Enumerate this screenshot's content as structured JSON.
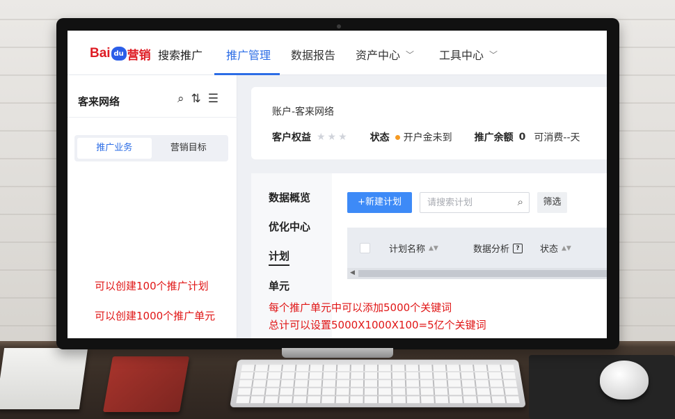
{
  "nav": {
    "logo_bai": "Bai",
    "logo_du": "du",
    "logo_yx": "营销",
    "product": "搜索推广",
    "items": [
      {
        "label": "推广管理",
        "active": true
      },
      {
        "label": "数据报告"
      },
      {
        "label": "资产中心"
      },
      {
        "label": "工具中心"
      }
    ]
  },
  "left": {
    "account_title": "客来网络",
    "tabs": [
      "推广业务",
      "营销目标"
    ],
    "notes": [
      "可以创建100个推广计划",
      "可以创建1000个推广单元"
    ]
  },
  "account": {
    "crumb": "账户-客来网络",
    "rights_label": "客户权益",
    "status_label": "状态",
    "status_value": "开户金未到",
    "balance_label": "推广余额",
    "balance_value": "0",
    "spend_text": "可消费--天"
  },
  "submenu": [
    "数据概览",
    "优化中心",
    "计划",
    "单元"
  ],
  "toolbar": {
    "new_plan": "+新建计划",
    "search_placeholder": "请搜索计划",
    "filter": "筛选"
  },
  "table": {
    "columns": [
      "计划名称",
      "数据分析",
      "状态"
    ]
  },
  "bottom_notes": [
    "每个推广单元中可以添加5000个关键词",
    "总计可以设置5000X1000X100=5亿个关键词"
  ],
  "colors": {
    "accent": "#2c6de6",
    "note_red": "#e01515",
    "status_orange": "#f59a23"
  }
}
